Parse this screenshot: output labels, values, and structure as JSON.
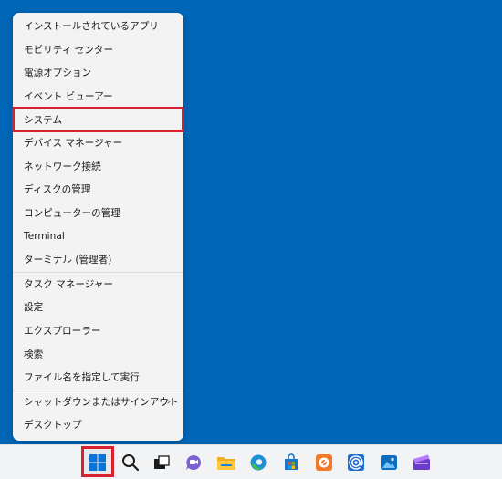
{
  "context_menu": {
    "items": [
      {
        "label": "インストールされているアプリ"
      },
      {
        "label": "モビリティ センター"
      },
      {
        "label": "電源オプション"
      },
      {
        "label": "イベント ビューアー"
      },
      {
        "label": "システム"
      },
      {
        "label": "デバイス マネージャー"
      },
      {
        "label": "ネットワーク接続"
      },
      {
        "label": "ディスクの管理"
      },
      {
        "label": "コンピューターの管理"
      },
      {
        "label": "Terminal"
      },
      {
        "label": "ターミナル (管理者)"
      },
      {
        "label": "タスク マネージャー"
      },
      {
        "label": "設定"
      },
      {
        "label": "エクスプローラー"
      },
      {
        "label": "検索"
      },
      {
        "label": "ファイル名を指定して実行"
      },
      {
        "label": "シャットダウンまたはサインアウト"
      },
      {
        "label": "デスクトップ"
      }
    ]
  },
  "taskbar": {
    "icons": [
      "windows-start-icon",
      "search-icon",
      "task-view-icon",
      "chat-icon",
      "file-explorer-icon",
      "edge-icon",
      "store-icon",
      "photo-app-icon",
      "mail-icon",
      "photos-icon",
      "clipchamp-icon"
    ]
  },
  "colors": {
    "desktop": "#0067b8",
    "highlight_border": "#d9212f",
    "menu_bg": "#f3f3f3",
    "taskbar_bg": "#f2f3f5"
  }
}
